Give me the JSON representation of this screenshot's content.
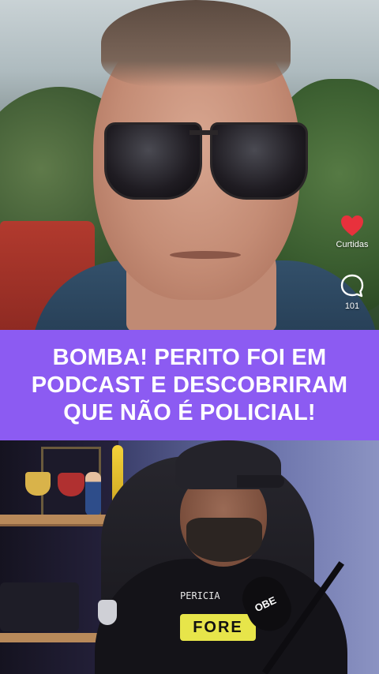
{
  "actions": {
    "like_label": "Curtidas",
    "comment_count": "101",
    "like_color": "#e8313c",
    "like_icon": "heart-icon",
    "comment_icon": "comment-icon"
  },
  "banner": {
    "headline": "BOMBA! PERITO FOI EM PODCAST E DESCOBRIRAM QUE NÃO É POLICIAL!",
    "background": "#8c5bf2"
  },
  "bottom_video": {
    "shirt_print": "FORE",
    "shirt_top_text": "PERICIA",
    "mic_label": "OBE"
  }
}
